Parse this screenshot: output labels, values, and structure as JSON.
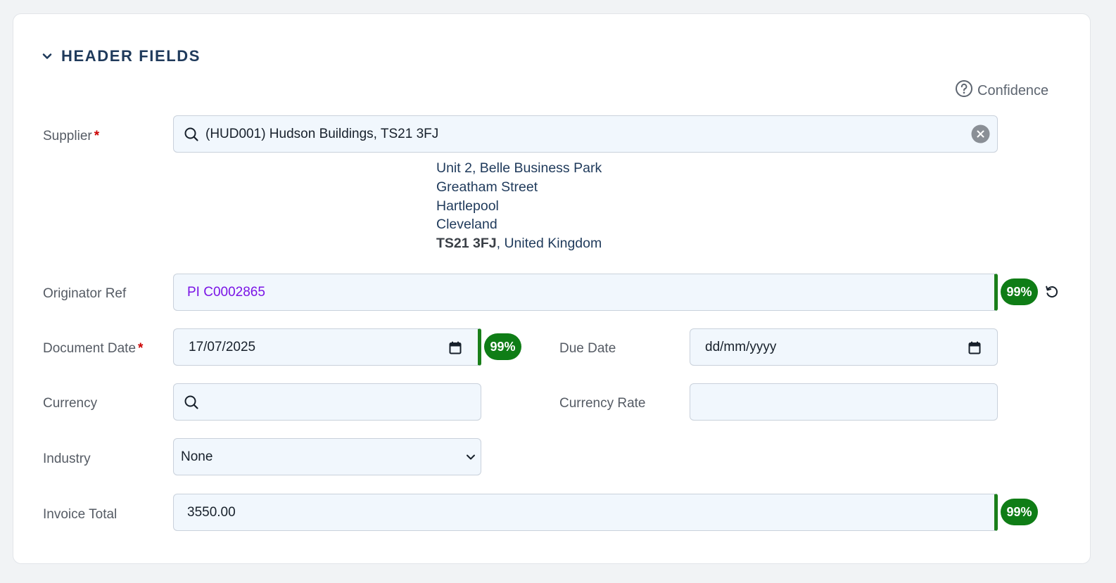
{
  "section": {
    "title": "HEADER FIELDS"
  },
  "confidence": {
    "label": "Confidence"
  },
  "supplier": {
    "label": "Supplier",
    "required_mark": "*",
    "value": "(HUD001) Hudson Buildings, TS21 3FJ",
    "address": {
      "line1": "Unit 2, Belle Business Park",
      "line2": "Greatham Street",
      "line3": "Hartlepool",
      "line4": "Cleveland",
      "postcode": "TS21 3FJ",
      "country": ", United Kingdom"
    }
  },
  "originator_ref": {
    "label": "Originator Ref",
    "value": "PI C0002865",
    "confidence": "99%",
    "value_color": "#7a14e6"
  },
  "document_date": {
    "label": "Document Date",
    "required_mark": "*",
    "value": "17/07/2025",
    "confidence": "99%"
  },
  "due_date": {
    "label": "Due Date",
    "placeholder": "dd/mm/yyyy"
  },
  "currency": {
    "label": "Currency",
    "value": ""
  },
  "currency_rate": {
    "label": "Currency Rate",
    "value": ""
  },
  "industry": {
    "label": "Industry",
    "selected": "None"
  },
  "invoice_total": {
    "label": "Invoice Total",
    "value": "3550.00",
    "confidence": "99%"
  },
  "colors": {
    "accent": "#1f3a5b",
    "confidence_green": "#0f7d16",
    "required": "#cc0000"
  }
}
